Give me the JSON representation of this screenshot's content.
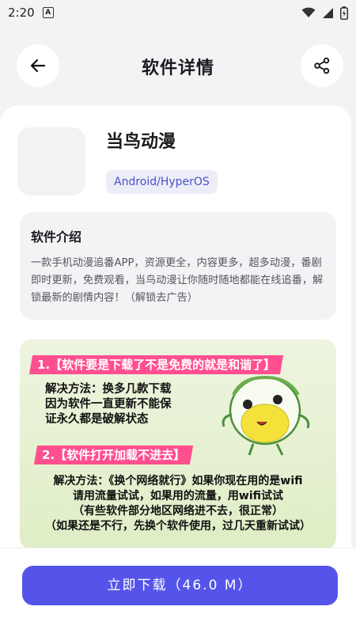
{
  "status_bar": {
    "time": "2:20",
    "notification_icon": "A",
    "icons": [
      "wifi-icon",
      "signal-icon",
      "battery-icon"
    ]
  },
  "header": {
    "title": "软件详情",
    "back_icon": "arrow-left-icon",
    "share_icon": "share-icon"
  },
  "app": {
    "name": "当鸟动漫",
    "platform": "Android/HyperOS"
  },
  "intro": {
    "title": "软件介绍",
    "text": "一款手机动漫追番APP，资源更全，内容更多，超多动漫，番剧即时更新，免费观看，当鸟动漫让你随时随地都能在线追番，解锁最新的剧情内容！（解锁去广告）"
  },
  "promo": {
    "banner1": "1.【软件要是下载了不是免费的就是和谐了】",
    "solution1": [
      "解决方法：换多几款下载",
      "因为软件一直更新不能保",
      "证永久都是破解状态"
    ],
    "banner2": "2.【软件打开加载不进去】",
    "solution2": [
      "解决方法：《换个网络就行》如果你现在用的是wifi",
      "请用流量试试，如果用的流量，用wifi试试",
      "（有些软件部分地区网络进不去，很正常）",
      "（如果还是不行，先换个软件使用，过几天重新试试）"
    ]
  },
  "download": {
    "label": "立即下载（46.0 M）"
  },
  "colors": {
    "accent": "#5554ea",
    "tag_text": "#4b50c9",
    "banner": "#ff4f8f"
  }
}
